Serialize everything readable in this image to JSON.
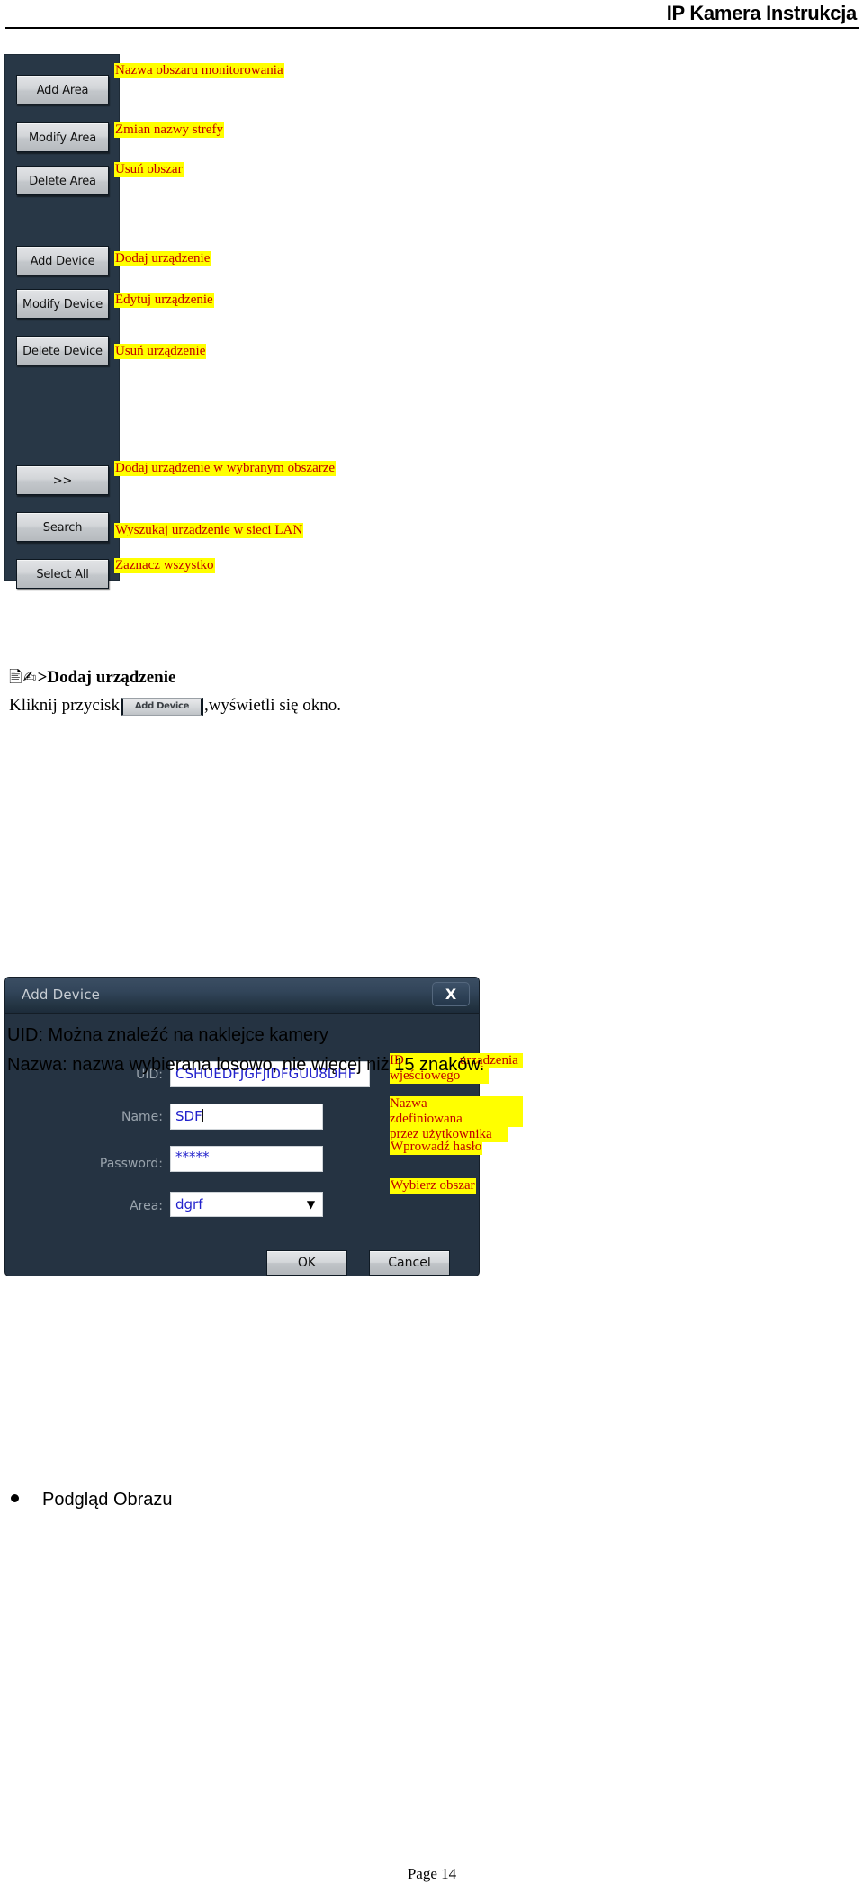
{
  "document": {
    "header_title": "IP Kamera Instrukcja",
    "footer": "Page 14"
  },
  "panel": {
    "buttons": [
      {
        "label": "Add Area",
        "annotation": "Nazwa obszaru monitorowania"
      },
      {
        "label": "Modify Area",
        "annotation": "Zmian nazwy strefy"
      },
      {
        "label": "Delete Area",
        "annotation": "Usuń obszar"
      },
      {
        "label": "Add Device",
        "annotation": "Dodaj urządzenie"
      },
      {
        "label": "Modify Device",
        "annotation": "Edytuj urządzenie"
      },
      {
        "label": "Delete Device",
        "annotation": "Usuń urządzenie"
      },
      {
        "label": ">>",
        "annotation": "Dodaj urządzenie w wybranym obszarze"
      },
      {
        "label": "Search",
        "annotation": "Wyszukaj urządzenie w sieci LAN"
      },
      {
        "label": "Select All",
        "annotation": "Zaznacz wszystko"
      }
    ]
  },
  "section": {
    "icon_glyphs": "🖹✍",
    "heading": ">Dodaj urządzenie",
    "instruction_before": "Kliknij przycisk",
    "instruction_button": "Add Device",
    "instruction_after": ",wyświetli się okno."
  },
  "dialog": {
    "title": "Add Device",
    "close_label": "X",
    "fields": [
      {
        "label": "UID:",
        "value": "CSHUEDFJGFJIDFGUU8DHF",
        "annotation_line1_a": "ID",
        "annotation_line1_b": "urządzenia",
        "annotation_line2": "wjeściowego"
      },
      {
        "label": "Name:",
        "value": "SDF",
        "annotation_line1_a": "Nazwa",
        "annotation_line1_b": "zdefiniowana",
        "annotation_line2": "przez użytkownika"
      },
      {
        "label": "Password:",
        "value": "*****",
        "annotation_line1_a": "Wprowadź hasło",
        "annotation_line1_b": "",
        "annotation_line2": ""
      },
      {
        "label": "Area:",
        "value": "dgrf",
        "annotation_line1_a": "Wybierz obszar",
        "annotation_line1_b": "",
        "annotation_line2": ""
      }
    ],
    "area_dropdown_arrow": "▼",
    "ok_label": "OK",
    "cancel_label": "Cancel"
  },
  "notes": {
    "uid_note": "UID: Można znaleźć na naklejce kamery",
    "name_note": "Nazwa: nazwa wybierana losowo, nie więcej niż 15 znaków.",
    "bullet_item": "Podgląd Obrazu"
  }
}
